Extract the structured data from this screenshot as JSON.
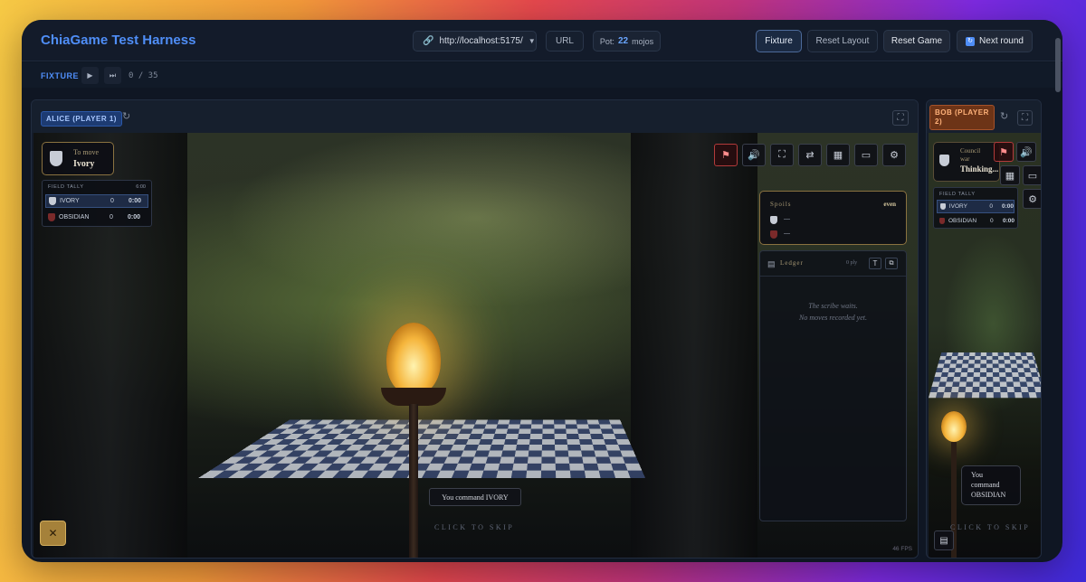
{
  "app": {
    "title": "ChiaGame Test Harness"
  },
  "header": {
    "url": "http://localhost:5175/",
    "url_button": "URL",
    "pot_label": "Pot:",
    "pot_value": "22",
    "pot_unit": "mojos",
    "buttons": {
      "fixture": "Fixture",
      "reset_layout": "Reset Layout",
      "reset_game": "Reset Game",
      "next_round": "Next round"
    }
  },
  "fixture_bar": {
    "label": "FIXTURE",
    "counter": "0 / 35"
  },
  "alice": {
    "tag": "ALICE (PLAYER 1)",
    "to_move_label": "To move",
    "to_move_value": "Ivory",
    "tally": {
      "title": "FIELD TALLY",
      "time": "6:00",
      "rows": [
        {
          "name": "IVORY",
          "score": "0",
          "clock": "0:00"
        },
        {
          "name": "OBSIDIAN",
          "score": "0",
          "clock": "0:00"
        }
      ]
    },
    "spoils": {
      "title": "Spoils",
      "status": "even",
      "rows": [
        "—",
        "—"
      ]
    },
    "ledger": {
      "title": "Ledger",
      "count": "0 ply",
      "empty_line1": "The scribe waits.",
      "empty_line2": "No moves recorded yet."
    },
    "command": "You command IVORY",
    "skip": "CLICK TO SKIP",
    "fps": "46 FPS"
  },
  "bob": {
    "tag_line1": "BOB (PLAYER",
    "tag_line2": "2)",
    "council_line1": "Council",
    "council_line2": "war",
    "thinking": "Thinking...",
    "tally": {
      "title": "FIELD TALLY",
      "rows": [
        {
          "name": "IVORY",
          "score": "0",
          "clock": "0:00"
        },
        {
          "name": "OBSIDIAN",
          "score": "0",
          "clock": "0:00"
        }
      ]
    },
    "command_line1": "You",
    "command_line2": "command",
    "command_line3": "OBSIDIAN",
    "skip": "CLICK TO SKIP"
  },
  "colors": {
    "accent": "#4f8ef7",
    "alice_tag": "#1d3b72",
    "bob_tag": "#6d3417",
    "gold": "#a5813a"
  }
}
